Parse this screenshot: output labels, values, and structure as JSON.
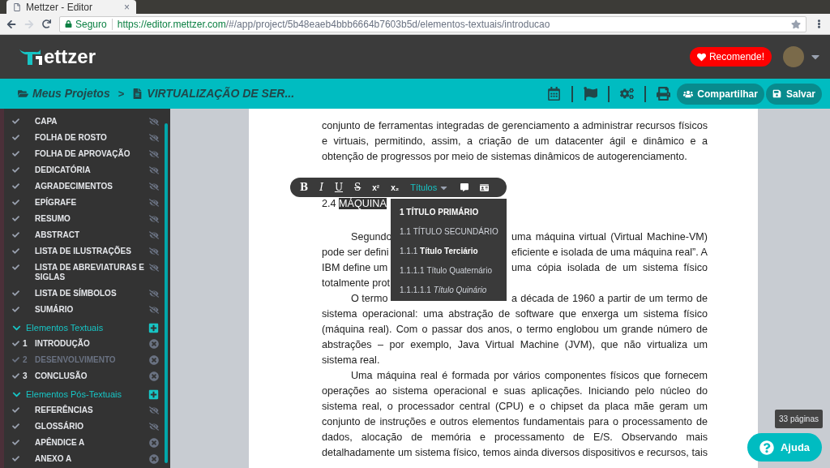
{
  "browser": {
    "tab_title": "Mettzer - Editor",
    "tab_close": "×",
    "secure_label": "Seguro",
    "url_host": "https://editor.mettzer.com",
    "url_path": "/#/app/project/5b48eaeb4bbb6664b7603b5d/elementos-textuais/introducao"
  },
  "header": {
    "logo_text": "ettzer",
    "recommend": "Recomende!"
  },
  "breadcrumb": {
    "root": "Meus Projetos",
    "separator": ">",
    "current": "VIRTUALIZAÇÃO DE SER..."
  },
  "actions": {
    "share": "Compartilhar",
    "save": "Salvar"
  },
  "sidebar": [
    {
      "items": [
        {
          "label": "CAPA",
          "kind": "hide",
          "dimmed": false
        },
        {
          "label": "FOLHA DE ROSTO",
          "kind": "hide",
          "dimmed": false
        },
        {
          "label": "FOLHA DE APROVAÇÃO",
          "kind": "hide",
          "dimmed": false
        },
        {
          "label": "DEDICATÓRIA",
          "kind": "hide",
          "dimmed": false
        },
        {
          "label": "AGRADECIMENTOS",
          "kind": "hide",
          "dimmed": false
        },
        {
          "label": "EPÍGRAFE",
          "kind": "hide",
          "dimmed": false
        },
        {
          "label": "RESUMO",
          "kind": "hide",
          "dimmed": false
        },
        {
          "label": "ABSTRACT",
          "kind": "hide",
          "dimmed": false
        },
        {
          "label": "LISTA DE ILUSTRAÇÕES",
          "kind": "hide",
          "dimmed": false
        },
        {
          "label": "LISTA DE ABREVIATURAS E SIGLAS",
          "kind": "hide",
          "dimmed": false
        },
        {
          "label": "LISTA DE SÍMBOLOS",
          "kind": "hide",
          "dimmed": false
        },
        {
          "label": "SUMÁRIO",
          "kind": "hide",
          "dimmed": false
        }
      ]
    },
    {
      "title": "Elementos Textuais",
      "expanded": true,
      "items": [
        {
          "number": "1",
          "label": "INTRODUÇÃO",
          "kind": "remove",
          "dimmed": false
        },
        {
          "number": "2",
          "label": "DESENVOLVIMENTO",
          "kind": "remove",
          "dimmed": true
        },
        {
          "number": "3",
          "label": "CONCLUSÃO",
          "kind": "remove",
          "dimmed": false
        }
      ]
    },
    {
      "title": "Elementos Pós-Textuais",
      "expanded": true,
      "items": [
        {
          "label": "REFERÊNCIAS",
          "kind": "hide",
          "dimmed": false
        },
        {
          "label": "GLOSSÁRIO",
          "kind": "hide",
          "dimmed": false
        },
        {
          "label": "APÊNDICE A",
          "kind": "remove",
          "dimmed": false
        },
        {
          "label": "ANEXO A",
          "kind": "remove",
          "dimmed": false
        }
      ]
    }
  ],
  "toolbar": {
    "buttons": [
      {
        "kind": "bold",
        "label": "B"
      },
      {
        "kind": "italic",
        "label": "I"
      },
      {
        "kind": "underline",
        "label": "U"
      },
      {
        "kind": "strike",
        "label": "S"
      },
      {
        "kind": "sup",
        "label": "x²"
      },
      {
        "kind": "sub",
        "label": "x₂"
      }
    ],
    "headings_label": "Títulos"
  },
  "headings_menu": [
    {
      "number": "1",
      "title": "TÍTULO PRIMÁRIO",
      "kind": "primary"
    },
    {
      "number": "1.1",
      "title": "TÍTULO SECUNDÁRIO",
      "kind": "secondary"
    },
    {
      "number": "1.1.1",
      "title": "Título Terciário",
      "kind": "tertiary"
    },
    {
      "number": "1.1.1.1",
      "title": "Título Quaternário",
      "kind": "quaternary"
    },
    {
      "number": "1.1.1.1.1",
      "title": "Título Quinário",
      "kind": "quinary"
    }
  ],
  "document": {
    "intro_lines": [
      {
        "text": "conjunto de ferramentas integradas de gerenciamento a administrar recursos físicos"
      },
      {
        "text": "e virtuais, permitindo, assim, a criação de um datacenter ágil e dinâmico e a"
      },
      {
        "text": "obtenção de progressos por meio de sistemas dinâmicos de autogerenciamento.",
        "last": true
      }
    ],
    "heading_number": "2.4",
    "heading_selected": "MÁQUINA",
    "body_lines": [
      {
        "left": "Segundo",
        "right": "uma máquina virtual (Virtual Machine-VM)",
        "indent": true
      },
      {
        "left": "pode ser defini",
        "right": "eficiente e isolada de uma máquina real”. A"
      },
      {
        "left": "IBM define um",
        "right": "uma cópia isolada de um sistema físico"
      },
      {
        "left": "totalmente prot"
      },
      {
        "left": "O termo",
        "right": "a década de 1960 a partir de um termo de",
        "indent": true
      },
      {
        "text": "sistema operacional: uma abstração de software que enxerga um sistema físico"
      },
      {
        "text": "(máquina real). Com o passar dos anos, o termo englobou um grande número de"
      },
      {
        "text": "abstrações – por exemplo, Java Virtual Machine (JVM), que não virtualiza um"
      },
      {
        "text": "sistema real.",
        "last": true
      },
      {
        "text": "Uma máquina real é formada por vários componentes físicos que fornecem",
        "indent": true
      },
      {
        "text": "operações ao sistema operacional e suas aplicações. Iniciando pelo núcleo do"
      },
      {
        "text": "sistema real, o processador central (CPU) e o chipset da placa mãe geram um"
      },
      {
        "text": "conjunto de instruções e outros elementos fundamentais para o processamento de"
      },
      {
        "text": "dados, alocação de memória e processamento de E/S. Observando mais"
      },
      {
        "text": "detalhadamente um sistema físico, temos ainda diversos dispositivos e recursos, tais"
      }
    ]
  },
  "pages_tooltip": "33 páginas",
  "help": "Ajuda"
}
